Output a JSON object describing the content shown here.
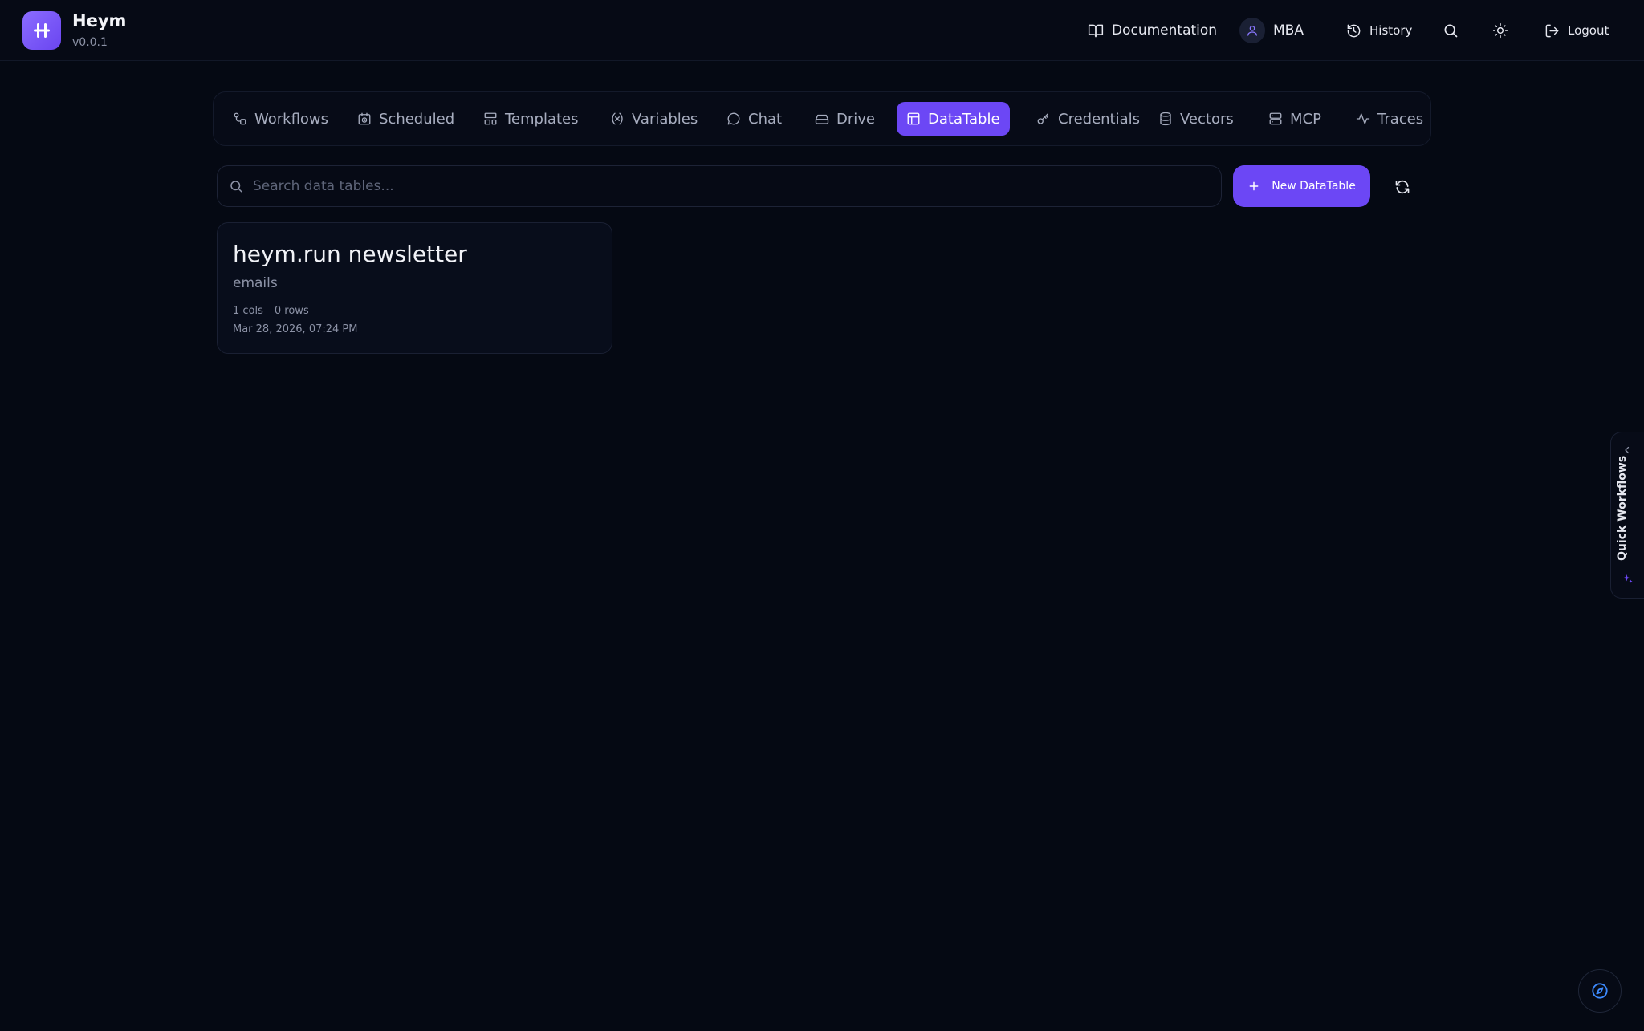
{
  "app": {
    "name": "Heym",
    "version": "v0.0.1"
  },
  "header": {
    "documentation_label": "Documentation",
    "user_label": "MBA",
    "history_label": "History",
    "logout_label": "Logout"
  },
  "nav": {
    "tabs": [
      {
        "label": "Workflows",
        "icon": "workflows-icon",
        "active": false
      },
      {
        "label": "Scheduled",
        "icon": "calendar-clock-icon",
        "active": false
      },
      {
        "label": "Templates",
        "icon": "template-icon",
        "active": false
      },
      {
        "label": "Variables",
        "icon": "variable-icon",
        "active": false
      },
      {
        "label": "Chat",
        "icon": "chat-bubble-icon",
        "active": false
      },
      {
        "label": "Drive",
        "icon": "drive-icon",
        "active": false
      },
      {
        "label": "DataTable",
        "icon": "table-icon",
        "active": true
      },
      {
        "label": "Credentials",
        "icon": "key-icon",
        "active": false
      },
      {
        "label": "Vectors",
        "icon": "database-icon",
        "active": false
      },
      {
        "label": "MCP",
        "icon": "server-icon",
        "active": false
      },
      {
        "label": "Traces",
        "icon": "activity-icon",
        "active": false
      }
    ]
  },
  "toolbar": {
    "search_placeholder": "Search data tables...",
    "search_value": "",
    "new_button_label": "New DataTable"
  },
  "tables": [
    {
      "title": "heym.run newsletter",
      "description": "emails",
      "cols": "1 cols",
      "rows": "0 rows",
      "date": "Mar 28, 2026, 07:24 PM"
    }
  ],
  "quick_panel": {
    "label": "Quick Workflows"
  },
  "colors": {
    "accent": "#6c47f5",
    "background": "#050913",
    "muted_text": "#8c92a6"
  }
}
